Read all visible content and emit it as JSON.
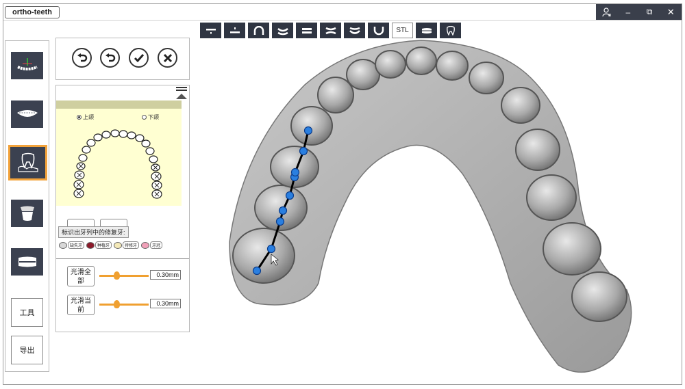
{
  "app": {
    "title": "ortho-teeth"
  },
  "window_controls": {
    "user": "👤",
    "minimize": "–",
    "restore": "⧉",
    "close": "✕"
  },
  "toolbar": {
    "items": [
      {
        "icon": "align-bottom-icon"
      },
      {
        "icon": "align-middle-icon"
      },
      {
        "icon": "arch-icon"
      },
      {
        "icon": "curve-down-icon"
      },
      {
        "icon": "parallel-lines-icon"
      },
      {
        "icon": "squeeze-icon"
      },
      {
        "icon": "lower-curve-icon"
      },
      {
        "icon": "u-shape-icon"
      },
      {
        "label": "STL"
      },
      {
        "icon": "band-icon"
      },
      {
        "icon": "tooth-outline-icon"
      }
    ]
  },
  "sidebar": {
    "icons": [
      "jaw-axis-icon",
      "full-arch-icon",
      "tooth-gum-icon",
      "crown-icon",
      "aligner-icon"
    ],
    "active_index": 2,
    "tools_label": "工具",
    "export_label": "导出"
  },
  "actions": [
    "undo-icon",
    "redo-icon",
    "confirm-icon",
    "cancel-icon"
  ],
  "panel": {
    "upper_label": "上颌",
    "lower_label": "下颌",
    "selected_jaw": "upper",
    "tooltip": "标识出牙列中的修复牙:",
    "legend": [
      {
        "label": "缺失牙",
        "color": "#d8d8d8"
      },
      {
        "label": "种植牙",
        "color": "#8b1a2a"
      },
      {
        "label": "待修牙",
        "color": "#f4e9b8"
      },
      {
        "label": "牙冠",
        "color": "#f0a0b8"
      }
    ],
    "smooth_all": {
      "label": "光滑全部",
      "value": "0.30mm",
      "level": 0.35
    },
    "smooth_current": {
      "label": "光滑当前",
      "value": "0.30mm",
      "level": 0.35
    }
  },
  "colors": {
    "accent": "#f0a030",
    "dark": "#2f3542",
    "chart_bg": "#ffffd2",
    "spline": "#1e73d8"
  }
}
